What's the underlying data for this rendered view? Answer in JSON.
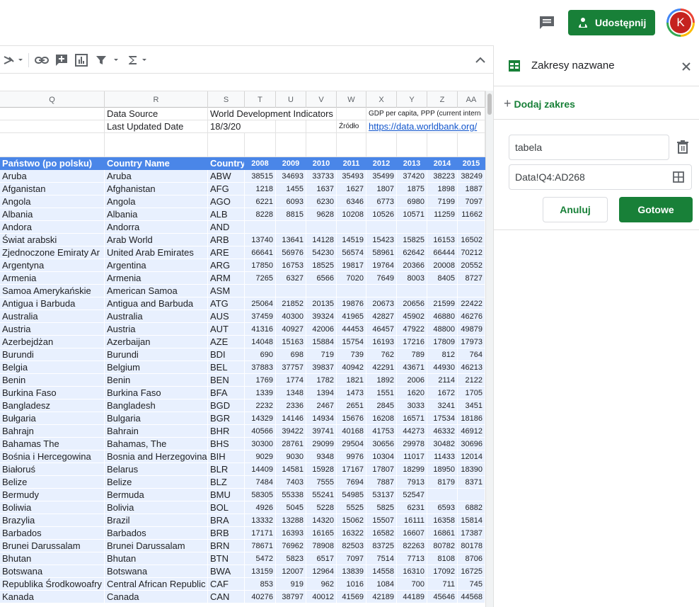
{
  "topbar": {
    "share_label": "Udostępnij",
    "avatar_letter": "K"
  },
  "grid": {
    "columns": [
      "Q",
      "R",
      "S",
      "T",
      "U",
      "V",
      "W",
      "X",
      "Y",
      "Z",
      "AA"
    ],
    "meta1": {
      "r": "Data Source",
      "s": "World Development Indicators",
      "x": "GDP per capita, PPP (current intern"
    },
    "meta2": {
      "r": "Last Updated Date",
      "s": "18/3/20",
      "w": "Źródło",
      "x": "https://data.worldbank.org/"
    },
    "header": {
      "q": "Państwo (po polsku)",
      "r": "Country Name",
      "s": "Country",
      "years": [
        "2008",
        "2009",
        "2010",
        "2011",
        "2012",
        "2013",
        "2014",
        "2015"
      ]
    },
    "rows": [
      [
        "Aruba",
        "Aruba",
        "ABW",
        "38515",
        "34693",
        "33733",
        "35493",
        "35499",
        "37420",
        "38223",
        "38249"
      ],
      [
        "Afganistan",
        "Afghanistan",
        "AFG",
        "1218",
        "1455",
        "1637",
        "1627",
        "1807",
        "1875",
        "1898",
        "1887"
      ],
      [
        "Angola",
        "Angola",
        "AGO",
        "6221",
        "6093",
        "6230",
        "6346",
        "6773",
        "6980",
        "7199",
        "7097"
      ],
      [
        "Albania",
        "Albania",
        "ALB",
        "8228",
        "8815",
        "9628",
        "10208",
        "10526",
        "10571",
        "11259",
        "11662"
      ],
      [
        "Andora",
        "Andorra",
        "AND",
        "",
        "",
        "",
        "",
        "",
        "",
        "",
        ""
      ],
      [
        "Świat arabski",
        "Arab World",
        "ARB",
        "13740",
        "13641",
        "14128",
        "14519",
        "15423",
        "15825",
        "16153",
        "16502"
      ],
      [
        "Zjednoczone Emiraty Ar",
        "United Arab Emirates",
        "ARE",
        "66641",
        "56976",
        "54230",
        "56574",
        "58961",
        "62642",
        "66444",
        "70212"
      ],
      [
        "Argentyna",
        "Argentina",
        "ARG",
        "17850",
        "16753",
        "18525",
        "19817",
        "19764",
        "20366",
        "20008",
        "20552"
      ],
      [
        "Armenia",
        "Armenia",
        "ARM",
        "7265",
        "6327",
        "6566",
        "7020",
        "7649",
        "8003",
        "8405",
        "8727"
      ],
      [
        "Samoa Amerykańskie",
        "American Samoa",
        "ASM",
        "",
        "",
        "",
        "",
        "",
        "",
        "",
        ""
      ],
      [
        "Antigua i Barbuda",
        "Antigua and Barbuda",
        "ATG",
        "25064",
        "21852",
        "20135",
        "19876",
        "20673",
        "20656",
        "21599",
        "22422"
      ],
      [
        "Australia",
        "Australia",
        "AUS",
        "37459",
        "40300",
        "39324",
        "41965",
        "42827",
        "45902",
        "46880",
        "46276"
      ],
      [
        "Austria",
        "Austria",
        "AUT",
        "41316",
        "40927",
        "42006",
        "44453",
        "46457",
        "47922",
        "48800",
        "49879"
      ],
      [
        "Azerbejdżan",
        "Azerbaijan",
        "AZE",
        "14048",
        "15163",
        "15884",
        "15754",
        "16193",
        "17216",
        "17809",
        "17973"
      ],
      [
        "Burundi",
        "Burundi",
        "BDI",
        "690",
        "698",
        "719",
        "739",
        "762",
        "789",
        "812",
        "764"
      ],
      [
        "Belgia",
        "Belgium",
        "BEL",
        "37883",
        "37757",
        "39837",
        "40942",
        "42291",
        "43671",
        "44930",
        "46213"
      ],
      [
        "Benin",
        "Benin",
        "BEN",
        "1769",
        "1774",
        "1782",
        "1821",
        "1892",
        "2006",
        "2114",
        "2122"
      ],
      [
        "Burkina Faso",
        "Burkina Faso",
        "BFA",
        "1339",
        "1348",
        "1394",
        "1473",
        "1551",
        "1620",
        "1672",
        "1705"
      ],
      [
        "Bangladesz",
        "Bangladesh",
        "BGD",
        "2232",
        "2336",
        "2467",
        "2651",
        "2845",
        "3033",
        "3241",
        "3451"
      ],
      [
        "Bułgaria",
        "Bulgaria",
        "BGR",
        "14329",
        "14146",
        "14934",
        "15676",
        "16208",
        "16571",
        "17534",
        "18186"
      ],
      [
        "Bahrajn",
        "Bahrain",
        "BHR",
        "40566",
        "39422",
        "39741",
        "40168",
        "41753",
        "44273",
        "46332",
        "46912"
      ],
      [
        "Bahamas The",
        "Bahamas, The",
        "BHS",
        "30300",
        "28761",
        "29099",
        "29504",
        "30656",
        "29978",
        "30482",
        "30696"
      ],
      [
        "Bośnia i Hercegowina",
        "Bosnia and Herzegovina",
        "BIH",
        "9029",
        "9030",
        "9348",
        "9976",
        "10304",
        "11017",
        "11433",
        "12014"
      ],
      [
        "Białoruś",
        "Belarus",
        "BLR",
        "14409",
        "14581",
        "15928",
        "17167",
        "17807",
        "18299",
        "18950",
        "18390"
      ],
      [
        "Belize",
        "Belize",
        "BLZ",
        "7484",
        "7403",
        "7555",
        "7694",
        "7887",
        "7913",
        "8179",
        "8371"
      ],
      [
        "Bermudy",
        "Bermuda",
        "BMU",
        "58305",
        "55338",
        "55241",
        "54985",
        "53137",
        "52547",
        "",
        ""
      ],
      [
        "Boliwia",
        "Bolivia",
        "BOL",
        "4926",
        "5045",
        "5228",
        "5525",
        "5825",
        "6231",
        "6593",
        "6882"
      ],
      [
        "Brazylia",
        "Brazil",
        "BRA",
        "13332",
        "13288",
        "14320",
        "15062",
        "15507",
        "16111",
        "16358",
        "15814"
      ],
      [
        "Barbados",
        "Barbados",
        "BRB",
        "17171",
        "16393",
        "16165",
        "16322",
        "16582",
        "16607",
        "16861",
        "17387"
      ],
      [
        "Brunei Darussalam",
        "Brunei Darussalam",
        "BRN",
        "78671",
        "76962",
        "78908",
        "82503",
        "83725",
        "82263",
        "80782",
        "80178"
      ],
      [
        "Bhutan",
        "Bhutan",
        "BTN",
        "5472",
        "5823",
        "6517",
        "7097",
        "7514",
        "7713",
        "8108",
        "8706"
      ],
      [
        "Botswana",
        "Botswana",
        "BWA",
        "13159",
        "12007",
        "12964",
        "13839",
        "14558",
        "16310",
        "17092",
        "16725"
      ],
      [
        "Republika Środkowoafry",
        "Central African Republic",
        "CAF",
        "853",
        "919",
        "962",
        "1016",
        "1084",
        "700",
        "711",
        "745"
      ],
      [
        "Kanada",
        "Canada",
        "CAN",
        "40276",
        "38797",
        "40012",
        "41569",
        "42189",
        "44189",
        "45646",
        "44568"
      ]
    ]
  },
  "panel": {
    "title": "Zakresy nazwane",
    "add_range": "Dodaj zakres",
    "name_value": "tabela",
    "range_value": "Data!Q4:AD268",
    "cancel_label": "Anuluj",
    "done_label": "Gotowe"
  },
  "colors": {
    "accent": "#188038",
    "header_blue": "#4a86e8",
    "band_blue": "#e8f0fe",
    "link": "#1155cc"
  }
}
